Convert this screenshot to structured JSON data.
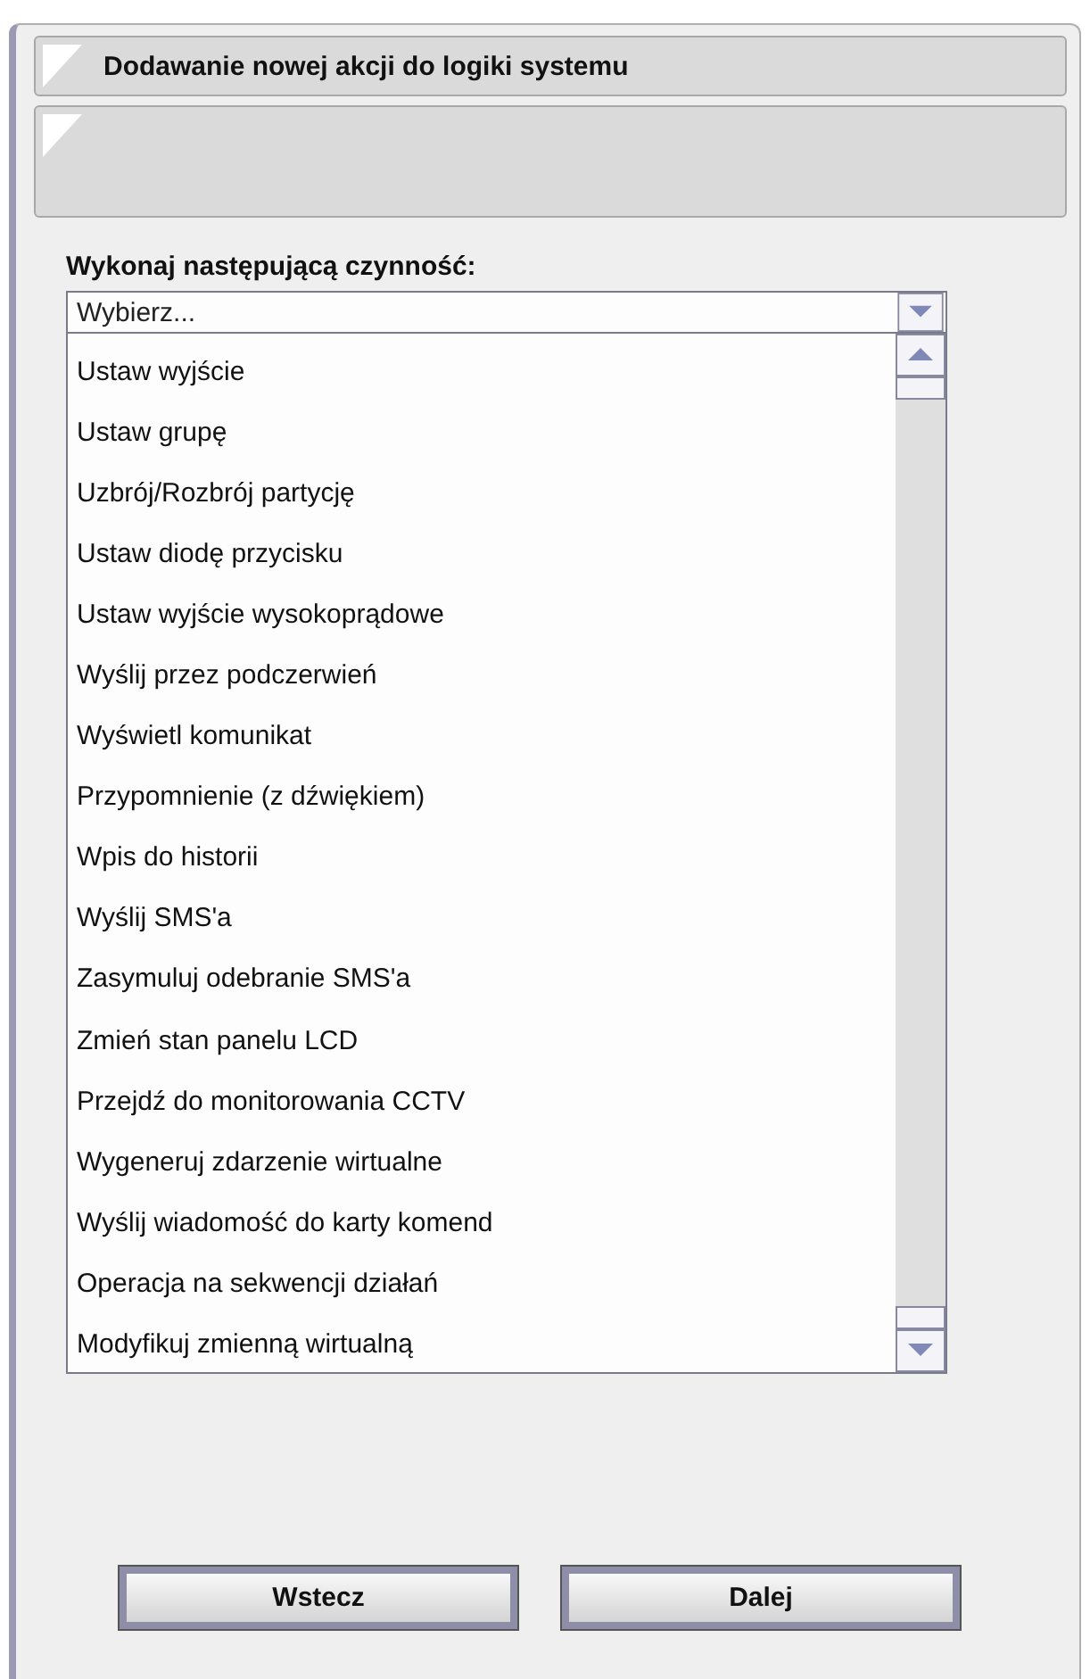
{
  "header": {
    "title": "Dodawanie nowej akcji do logiki systemu"
  },
  "form": {
    "label": "Wykonaj następującą czynność:",
    "dropdown": {
      "value": "Wybierz..."
    },
    "options": [
      "Ustaw wyjście",
      "Ustaw grupę",
      "Uzbrój/Rozbrój partycję",
      "Ustaw diodę przycisku",
      "Ustaw wyjście wysokoprądowe",
      "Wyślij przez podczerwień",
      "Wyświetl komunikat",
      "Przypomnienie (z dźwiękiem)",
      "Wpis do historii",
      "Wyślij SMS'a",
      "Zasymuluj odebranie SMS'a",
      "Zmień stan panelu LCD",
      "Przejdź do monitorowania CCTV",
      "Wygeneruj zdarzenie wirtualne",
      "Wyślij wiadomość do karty komend",
      "Operacja na sekwencji działań",
      "Modyfikuj zmienną wirtualną"
    ]
  },
  "buttons": [
    "Wstecz",
    "Dalej"
  ]
}
